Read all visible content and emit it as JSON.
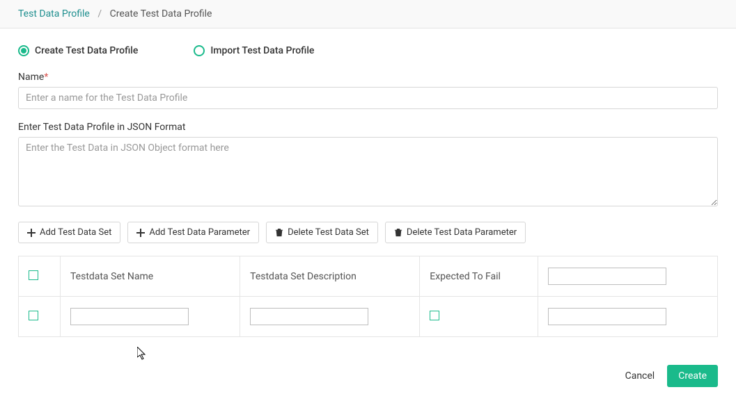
{
  "breadcrumb": {
    "parent": "Test Data Profile",
    "separator": "/",
    "current": "Create Test Data Profile"
  },
  "radios": {
    "create": "Create Test Data Profile",
    "import": "Import Test Data Profile"
  },
  "name_field": {
    "label": "Name",
    "placeholder": "Enter a name for the Test Data Profile",
    "value": ""
  },
  "json_field": {
    "label": "Enter Test Data Profile in JSON Format",
    "placeholder": "Enter the Test Data in JSON Object format here",
    "value": ""
  },
  "toolbar": {
    "add_set": "Add Test Data Set",
    "add_param": "Add Test Data Parameter",
    "delete_set": "Delete Test Data Set",
    "delete_param": "Delete Test Data Parameter"
  },
  "table": {
    "headers": {
      "name": "Testdata Set Name",
      "desc": "Testdata Set Description",
      "fail": "Expected To Fail"
    },
    "row": {
      "name": "",
      "desc": "",
      "extra": ""
    }
  },
  "footer": {
    "cancel": "Cancel",
    "create": "Create"
  }
}
